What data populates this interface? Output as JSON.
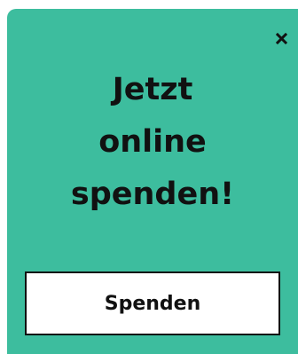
{
  "popup": {
    "background_color": "#3dbd9e",
    "close_icon": "close-icon",
    "headline": {
      "line1": "Jetzt",
      "line2": "online",
      "line3": "spenden!"
    },
    "button_label": "Spenden"
  }
}
